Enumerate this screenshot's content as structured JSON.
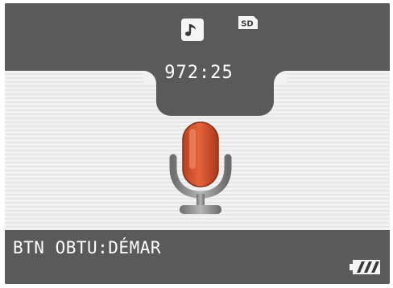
{
  "header": {
    "mode_icon": "music-note-icon",
    "storage_icon": "sd-card-icon",
    "storage_label": "SD",
    "counter": "972:25"
  },
  "center": {
    "icon": "microphone-icon"
  },
  "footer": {
    "status": "BTN OBTU:DÉMAR",
    "battery_icon": "battery-icon"
  },
  "colors": {
    "band": "#5a5a5a",
    "panel": "#f2f2f2",
    "mic_body": "#d5532c",
    "text": "#ffffff"
  }
}
